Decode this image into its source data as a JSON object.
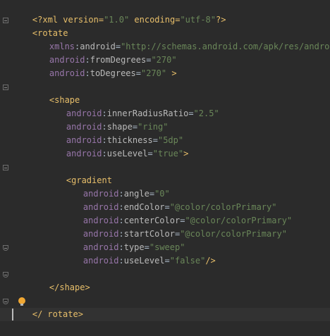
{
  "editor": {
    "lines": [
      {
        "pre": "<?xml version=",
        "val1": "\"1.0\"",
        "mid": " encoding=",
        "val2": "\"utf-8\"",
        "post": "?>"
      },
      {
        "tag": "<rotate"
      },
      {
        "ns": "xmlns",
        "sep": ":",
        "attr": "android",
        "eq": "=",
        "val": "\"http://schemas.android.com/apk/res/android\""
      },
      {
        "ns": "android",
        "sep": ":",
        "attr": "fromDegrees",
        "eq": "=",
        "val": "\"270\""
      },
      {
        "ns": "android",
        "sep": ":",
        "attr": "toDegrees",
        "eq": "=",
        "val": "\"270\"",
        "post": " >"
      },
      {
        "tag": "<shape"
      },
      {
        "ns": "android",
        "sep": ":",
        "attr": "innerRadiusRatio",
        "eq": "=",
        "val": "\"2.5\""
      },
      {
        "ns": "android",
        "sep": ":",
        "attr": "shape",
        "eq": "=",
        "val": "\"ring\""
      },
      {
        "ns": "android",
        "sep": ":",
        "attr": "thickness",
        "eq": "=",
        "val": "\"5dp\""
      },
      {
        "ns": "android",
        "sep": ":",
        "attr": "useLevel",
        "eq": "=",
        "val": "\"true\"",
        "post": ">"
      },
      {
        "tag": "<gradient"
      },
      {
        "ns": "android",
        "sep": ":",
        "attr": "angle",
        "eq": "=",
        "val": "\"0\""
      },
      {
        "ns": "android",
        "sep": ":",
        "attr": "endColor",
        "eq": "=",
        "val": "\"@color/colorPrimary\""
      },
      {
        "ns": "android",
        "sep": ":",
        "attr": "centerColor",
        "eq": "=",
        "val": "\"@color/colorPrimary\""
      },
      {
        "ns": "android",
        "sep": ":",
        "attr": "startColor",
        "eq": "=",
        "val": "\"@color/colorPrimary\""
      },
      {
        "ns": "android",
        "sep": ":",
        "attr": "type",
        "eq": "=",
        "val": "\"sweep\""
      },
      {
        "ns": "android",
        "sep": ":",
        "attr": "useLevel",
        "eq": "=",
        "val": "\"false\"",
        "post": "/>"
      },
      {
        "tag": "</shape>"
      },
      {
        "tag_a": "</",
        "tag_b": "rotate>"
      }
    ]
  },
  "colors": {
    "background": "#2b2b2b",
    "tag": "#e8bf6a",
    "namespace": "#9876aa",
    "attribute": "#bababa",
    "value": "#6a8759",
    "text": "#a9b7c6"
  }
}
